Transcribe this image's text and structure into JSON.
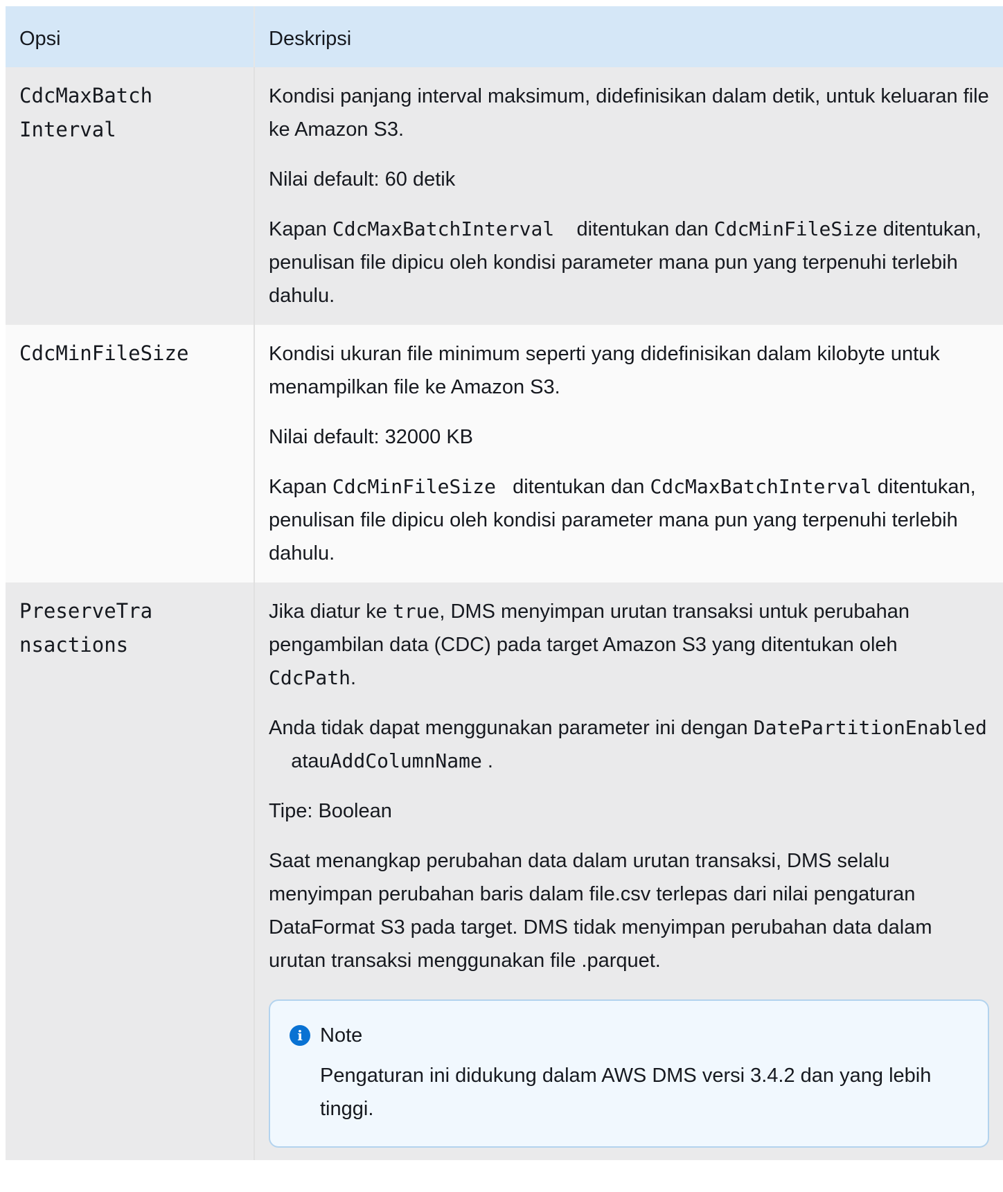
{
  "header": {
    "col1": "Opsi",
    "col2": "Deskripsi"
  },
  "rows": [
    {
      "option": "CdcMaxBatchInterval",
      "p1": "Kondisi panjang interval maksimum, didefinisikan dalam detik, untuk keluaran file ke Amazon S3.",
      "p2": "Nilai default: 60 detik",
      "p3": {
        "a": "Kapan ",
        "code1": "CdcMaxBatchInterval",
        "b": "    ditentukan dan ",
        "code2": "CdcMinFileSize",
        "c": " ditentukan, penulisan file dipicu oleh kondisi parameter mana pun yang terpenuhi terlebih dahulu."
      }
    },
    {
      "option": "CdcMinFileSize",
      "p1": "Kondisi ukuran file minimum seperti yang didefinisikan dalam kilobyte untuk menampilkan file ke Amazon S3.",
      "p2": "Nilai default: 32000 KB",
      "p3": {
        "a": "Kapan ",
        "code1": "CdcMinFileSize",
        "b": "   ditentukan dan ",
        "code2": "CdcMaxBatchInterval",
        "c": " ditentukan, penulisan file dipicu oleh kondisi parameter mana pun yang terpenuhi terlebih dahulu."
      }
    },
    {
      "option": "PreserveTransactions",
      "p1": {
        "a": "Jika diatur ke ",
        "code1": "true",
        "b": ", DMS menyimpan urutan transaksi untuk perubahan pengambilan data (CDC) pada target Amazon S3 yang ditentukan oleh ",
        "code2": "CdcPath",
        "c": "."
      },
      "p2": {
        "a": "Anda tidak dapat menggunakan parameter ini dengan ",
        "code1": "DatePartitionEnabled",
        "b": "    atau",
        "code2": "AddColumnName",
        "c": " ."
      },
      "p3": "Tipe: Boolean",
      "p4": "Saat menangkap perubahan data dalam urutan transaksi, DMS selalu menyimpan perubahan baris dalam file.csv terlepas dari nilai pengaturan DataFormat S3 pada target. DMS tidak menyimpan perubahan data dalam urutan transaksi menggunakan file .parquet.",
      "note": {
        "icon": "info-icon",
        "title": "Note",
        "body": "Pengaturan ini didukung dalam AWS DMS versi 3.4.2 dan yang lebih tinggi."
      }
    }
  ]
}
